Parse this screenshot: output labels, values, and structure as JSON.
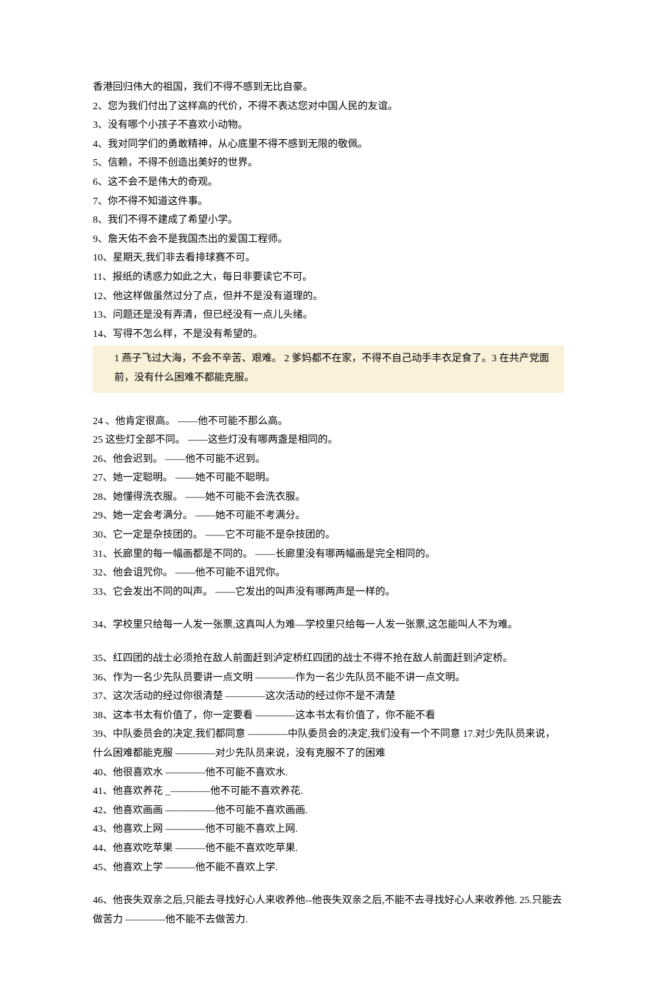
{
  "block1": [
    "香港回归伟大的祖国，我们不得不感到无比自豪。",
    "2、您为我们付出了这样高的代价，不得不表达您对中国人民的友谊。",
    "3、没有哪个小孩子不喜欢小动物。",
    "4、我对同学们的勇敢精神，从心底里不得不感到无限的敬佩。",
    "5、信赖，不得不创造出美好的世界。",
    "6、这不会不是伟大的奇观。",
    "7、你不得不知道这件事。",
    "8、我们不得不建成了希望小学。",
    "9、詹天佑不会不是我国杰出的爱国工程师。",
    "10、星期天,我们非去看排球赛不可。",
    "11、报纸的诱惑力如此之大，每日非要读它不可。",
    "12、他这样做虽然过分了点，但并不是没有道理的。",
    "13、问题还是没有弄清，但已经没有一点儿头绪。",
    "14、写得不怎么样，不是没有希望的。"
  ],
  "highlight": "1 燕子飞过大海，不会不辛苦、艰难。  2 爹妈都不在家，不得不自己动手丰衣足食了。3 在共产党面前，没有什么困难不都能克服。",
  "block2": [
    "24 、他肯定很高。 ——他不可能不那么高。",
    "25 这些灯全部不同。 ——这些灯没有哪两盏是相同的。",
    "26、他会迟到。 ——他不可能不迟到。",
    "27、她一定聪明。 ——她不可能不聪明。",
    "28、她懂得洗衣服。 ——她不可能不会洗衣服。",
    "29、她一定会考满分。 ——她不可能不考满分。",
    "30、它一定是杂技团的。 ——它不可能不是杂技团的。",
    "31、长廊里的每一幅画都是不同的。 ——长廊里没有哪两幅画是完全相同的。",
    "32、他会诅咒你。 ——他不可能不诅咒你。",
    "33、它会发出不同的叫声。 ——它发出的叫声没有哪两声是一样的。"
  ],
  "block3": [
    "34、学校里只给每一人发一张票,这真叫人为难—学校里只给每一人发一张票,这怎能叫人不为难。"
  ],
  "block4": [
    "35、红四团的战士必须抢在敌人前面赶到泸定桥红四团的战士不得不抢在敌人前面赶到泸定桥。",
    "36、作为一名少先队员要讲一点文明 ————作为一名少先队员不能不讲一点文明。",
    "37、这次活动的经过你很清楚 ————这次活动的经过你不是不清楚",
    "38、这本书太有价值了，你一定要看 ————这本书太有价值了，你不能不看",
    "39、中队委员会的决定,我们都同意 ————中队委员会的决定,我们没有一个不同意 17.对少先队员来说，什么困难都能克服 ————对少先队员来说，没有克服不了的困难",
    "40、他很喜欢水 ————他不可能不喜欢水.",
    "41、他喜欢养花 _————他不可能不喜欢养花.",
    "42、他喜欢画画 —————他不可能不喜欢画画.",
    "43、他喜欢上网 ————他不可能不喜欢上网.",
    "44、他喜欢吃苹果 ———他不能不喜欢吃苹果.",
    "45、他喜欢上学 ———他不能不喜欢上学."
  ],
  "block5": [
    "46、他丧失双亲之后,只能去寻找好心人来收养他--他丧失双亲之后,不能不去寻找好心人来收养他. 25.只能去做苦力 ————他不能不去做苦力."
  ]
}
